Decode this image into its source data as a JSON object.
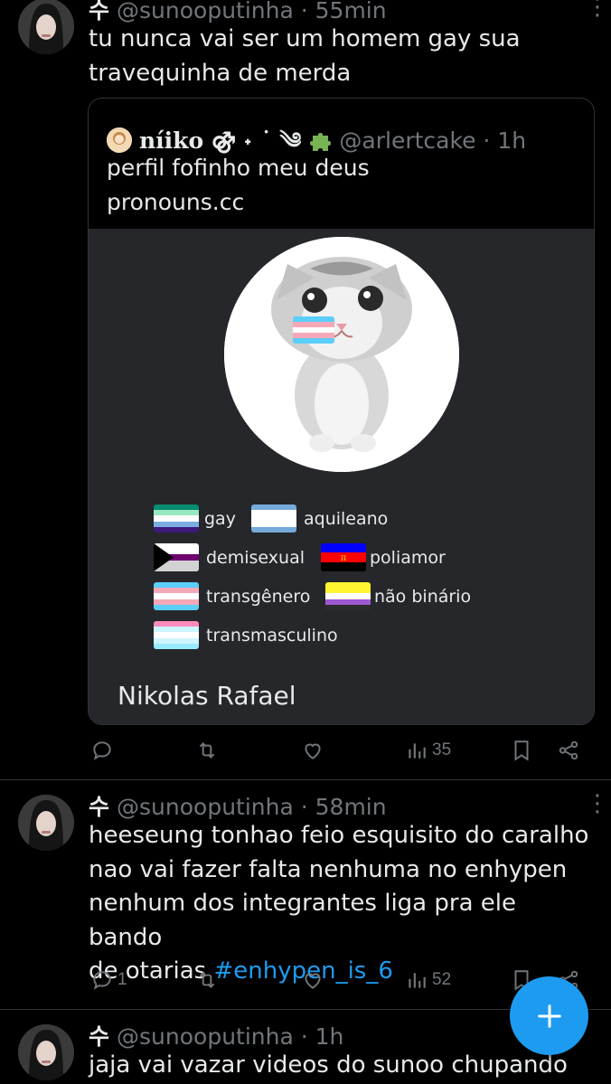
{
  "tweets": [
    {
      "name": "수",
      "handle": "@sunooputinha",
      "time": "· 55min",
      "text_lines": [
        "tu nunca vai ser um homem gay sua",
        "travequinha de merda"
      ],
      "quote": {
        "name": "níiko ⚣ ˖ ˙ ༄",
        "handle": "@arlertcake",
        "time": "· 1h",
        "text_lines": [
          "perfil fofinho meu deus",
          "pronouns.cc"
        ],
        "profile": {
          "flags": [
            {
              "label": "gay",
              "colors": [
                "#078d70",
                "#98e8c1",
                "#ffffff",
                "#7bade2",
                "#3d1a78"
              ]
            },
            {
              "label": "aquileano",
              "colors": [
                "#75aadb",
                "#ffffff",
                "#ffffff",
                "#ffffff",
                "#75aadb"
              ]
            },
            {
              "label": "demisexual",
              "colors": [
                "#ffffff",
                "#ffffff",
                "#6e0070",
                "#d2d2d2",
                "#d2d2d2"
              ]
            },
            {
              "label": "poliamor",
              "colors": [
                "#0000ff",
                "#0000ff",
                "#ff0000",
                "#000000",
                "#000000"
              ]
            },
            {
              "label": "transgênero",
              "colors": [
                "#5bcefa",
                "#f5a9b8",
                "#ffffff",
                "#f5a9b8",
                "#5bcefa"
              ]
            },
            {
              "label": "não binário",
              "colors": [
                "#fff430",
                "#fff430",
                "#ffffff",
                "#9c59d1",
                "#2c2c2c"
              ]
            },
            {
              "label": "transmasculino",
              "colors": [
                "#ff8abd",
                "#cdf5fe",
                "#ffffff",
                "#cdf5fe",
                "#9aebff"
              ]
            }
          ],
          "display_name": "Nikolas Rafael"
        }
      },
      "actions": {
        "replies": "",
        "retweets": "",
        "likes": "",
        "views": "35"
      }
    },
    {
      "name": "수",
      "handle": "@sunooputinha",
      "time": "· 58min",
      "text_lines": [
        "heeseung tonhao feio esquisito do caralho",
        "nao vai fazer falta nenhuma no enhypen",
        "nenhum dos integrantes liga pra ele bando",
        "de otarias "
      ],
      "hashtag": "#enhypen_is_6",
      "actions": {
        "replies": "1",
        "retweets": "",
        "likes": "",
        "views": "52"
      }
    },
    {
      "name": "수",
      "handle": "@sunooputinha",
      "time": "· 1h",
      "text_lines": [
        "jaja vai vazar videos do sunoo chupando"
      ]
    }
  ],
  "colors": {
    "accent": "#1d9bf0",
    "muted": "#71767b",
    "text": "#e7e9ea",
    "card_bg": "#25272b"
  },
  "icons": {
    "reply": "reply-icon",
    "retweet": "retweet-icon",
    "like": "heart-icon",
    "views": "views-icon",
    "bookmark": "bookmark-icon",
    "share": "share-icon",
    "compose": "plus-icon"
  }
}
